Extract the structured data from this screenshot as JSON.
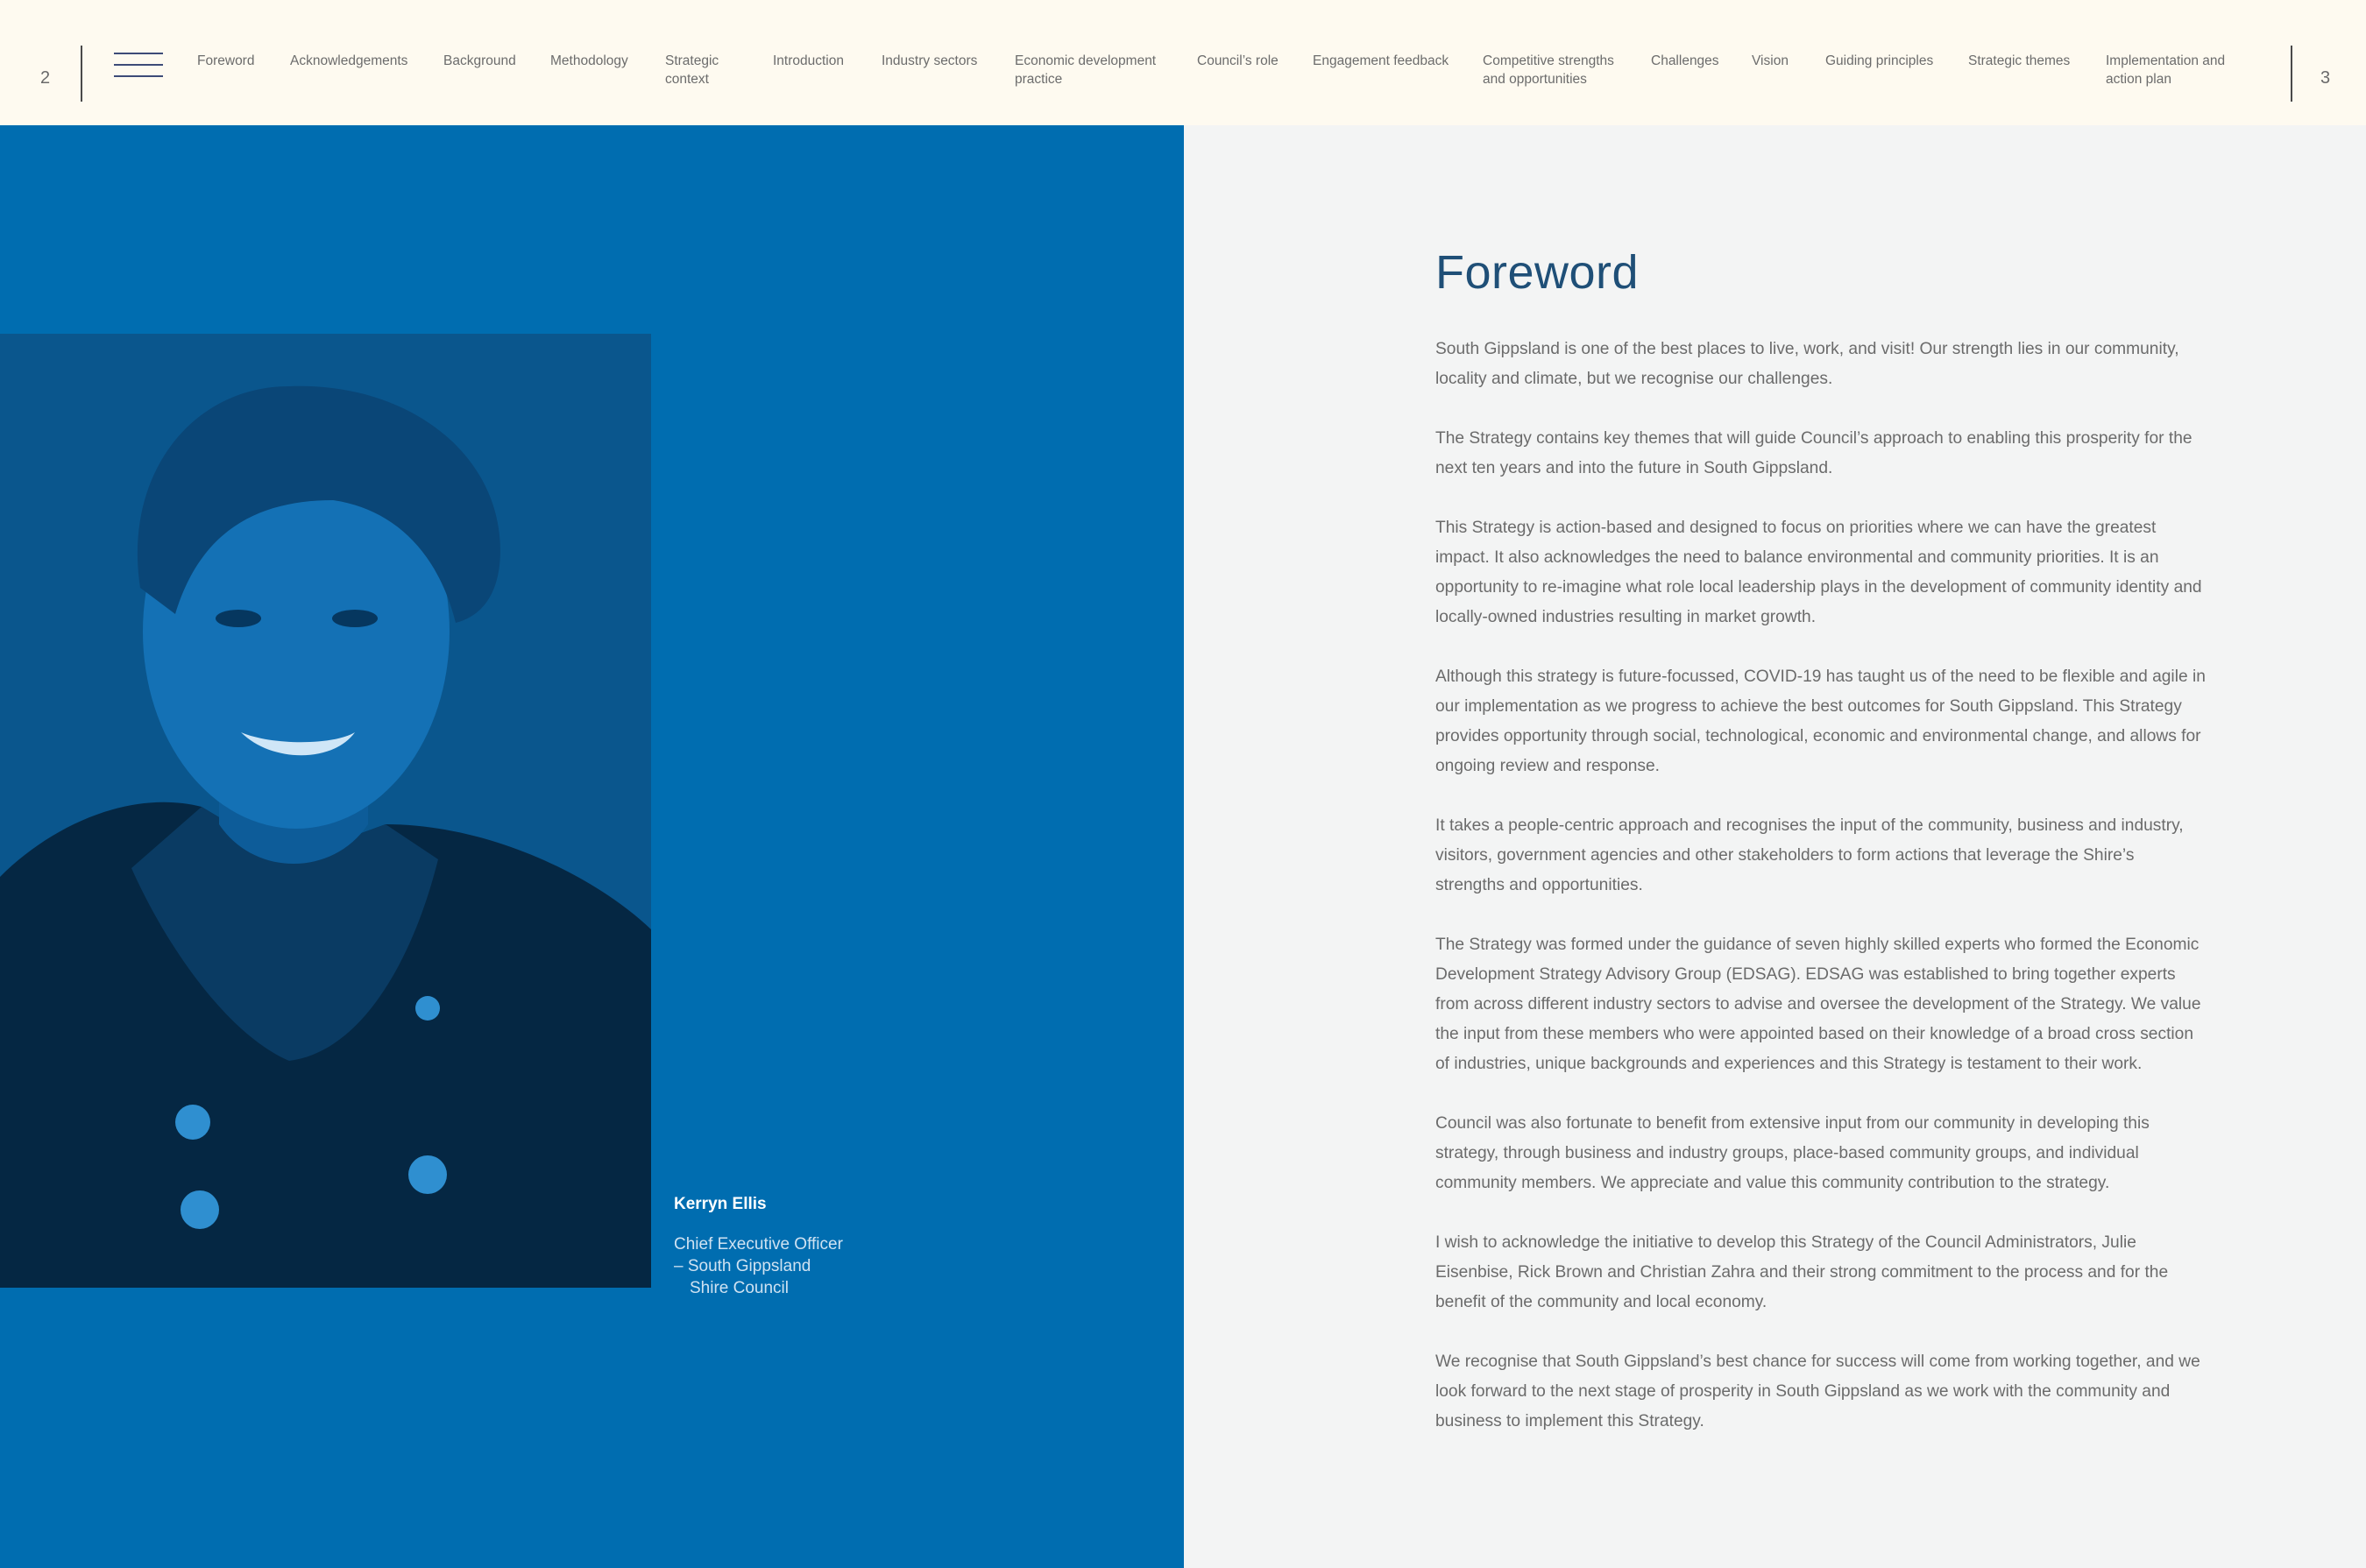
{
  "nav": {
    "page_left": "2",
    "page_right": "3",
    "items": [
      {
        "label": "Foreword"
      },
      {
        "label": "Acknowledgements"
      },
      {
        "label": "Background"
      },
      {
        "label": "Methodology"
      },
      {
        "label": "Strategic context"
      },
      {
        "label": "Introduction"
      },
      {
        "label": "Industry sectors"
      },
      {
        "label": "Economic development practice"
      },
      {
        "label": "Council’s role"
      },
      {
        "label": "Engagement feedback"
      },
      {
        "label": "Competitive strengths and opportunities"
      },
      {
        "label": "Challenges"
      },
      {
        "label": "Vision"
      },
      {
        "label": "Guiding principles"
      },
      {
        "label": "Strategic themes"
      },
      {
        "label": "Implementation and action plan"
      }
    ]
  },
  "portrait": {
    "name": "Kerryn Ellis",
    "role_lines": [
      "Chief Executive Officer",
      "– South Gippsland",
      "Shire Council"
    ]
  },
  "foreword": {
    "title": "Foreword",
    "paragraphs": [
      "South Gippsland is one of the best places to live, work, and visit! Our strength lies in our community, locality and climate, but we recognise our challenges.",
      "The Strategy contains key themes that will guide Council’s approach to enabling this prosperity for the next ten years and into the future in South Gippsland.",
      "This Strategy is action-based and designed to focus on priorities where we can have the greatest impact. It also acknowledges the need to balance environmental and community priorities. It is an opportunity to re-imagine what role local leadership plays in the development of community identity and locally-owned industries resulting in market growth.",
      "Although this strategy is future-focussed, COVID-19 has taught us of the need to be flexible and agile in our implementation as we progress to achieve the best outcomes for South Gippsland. This Strategy provides opportunity through social, technological, economic and environmental change, and allows for ongoing review and response.",
      "It takes a people-centric approach and recognises the input of the community, business and industry, visitors, government agencies and other stakeholders to form actions that leverage the Shire’s strengths and opportunities.",
      "The Strategy was formed under the guidance of seven highly skilled experts who formed the Economic Development Strategy Advisory Group (EDSAG). EDSAG was established to bring together experts from across different industry sectors to advise and oversee the development of the Strategy. We value the input from these members who were appointed based on their knowledge of a broad cross section of industries, unique backgrounds and experiences and this Strategy is testament to their work.",
      "Council was also fortunate to benefit from extensive input from our community in developing this strategy, through business and industry groups, place-based community groups, and individual community members. We appreciate and value this community contribution to the strategy.",
      "I wish to acknowledge the initiative to develop this Strategy of the Council Administrators, Julie Eisenbise, Rick Brown and Christian Zahra and their strong commitment to the process and for the benefit of the community and local economy.",
      "We recognise that South Gippsland’s best chance for success will come from working together, and we look forward to the next stage of prosperity in South Gippsland as we work with the community and business to implement this Strategy."
    ]
  }
}
